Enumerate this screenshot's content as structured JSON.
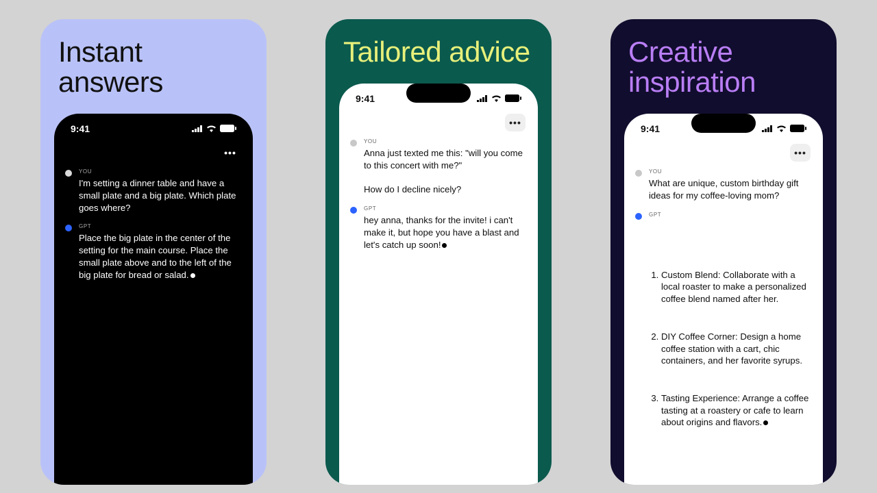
{
  "status_time": "9:41",
  "labels": {
    "you": "YOU",
    "gpt": "GPT"
  },
  "cards": [
    {
      "title": "Instant\nanswers",
      "theme": "dark",
      "you_text": "I'm setting a dinner table and have a small plate and a big plate. Which plate goes where?",
      "gpt_text": "Place the big plate in the center of the setting for the main course. Place the small plate above and to the left of the big plate for bread or salad."
    },
    {
      "title": "Tailored\nadvice",
      "theme": "light",
      "you_text": "Anna just texted me this: \"will you come to this concert with me?\"\n\nHow do I decline nicely?",
      "gpt_text": "hey anna, thanks for the invite! i can't make it, but hope you have a blast and let's catch up soon!"
    },
    {
      "title": "Creative\ninspiration",
      "theme": "light",
      "you_text": "What are unique, custom birthday gift ideas for my coffee-loving mom?",
      "gpt_list": [
        "Custom Blend: Collaborate with a local roaster to make a personalized coffee blend named after her.",
        "DIY Coffee Corner: Design a home coffee station with a cart, chic containers, and her favorite syrups.",
        "Tasting Experience: Arrange a coffee tasting at a roastery or cafe to learn about origins and flavors."
      ]
    }
  ]
}
